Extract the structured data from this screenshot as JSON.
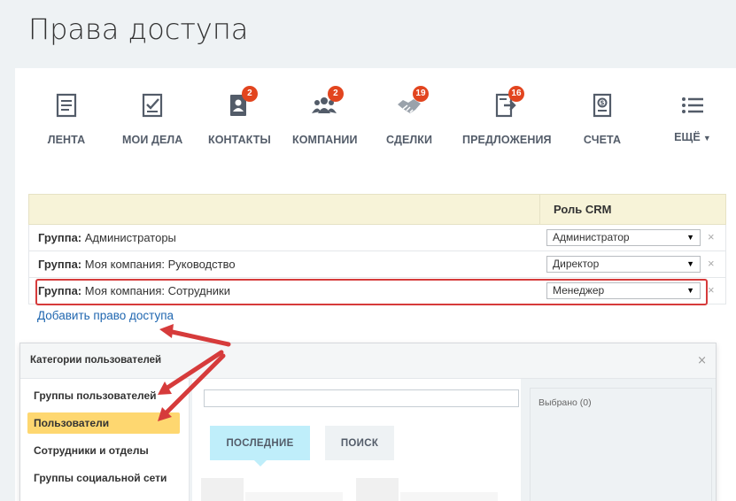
{
  "page": {
    "title": "Права доступа"
  },
  "toolbar": {
    "items": [
      {
        "label": "ЛЕНТА",
        "icon": "feed-icon",
        "badge": ""
      },
      {
        "label": "МОИ ДЕЛА",
        "icon": "tasks-icon",
        "badge": ""
      },
      {
        "label": "КОНТАКТЫ",
        "icon": "contacts-icon",
        "badge": "2"
      },
      {
        "label": "КОМПАНИИ",
        "icon": "companies-icon",
        "badge": "2"
      },
      {
        "label": "СДЕЛКИ",
        "icon": "deals-icon",
        "badge": "19"
      },
      {
        "label": "ПРЕДЛОЖЕНИЯ",
        "icon": "quotes-icon",
        "badge": "16"
      },
      {
        "label": "СЧЕТА",
        "icon": "invoices-icon",
        "badge": ""
      },
      {
        "label": "ЕЩЁ",
        "icon": "more-icon",
        "badge": ""
      }
    ]
  },
  "rights": {
    "role_header": "Роль CRM",
    "rows": [
      {
        "prefix": "Группа:",
        "name": "Администраторы",
        "role": "Администратор"
      },
      {
        "prefix": "Группа:",
        "name": "Моя компания: Руководство",
        "role": "Директор"
      },
      {
        "prefix": "Группа:",
        "name": "Моя компания: Сотрудники",
        "role": "Менеджер"
      }
    ],
    "add_link": "Добавить право доступа"
  },
  "dialog": {
    "title": "Категории пользователей",
    "categories": [
      "Группы пользователей",
      "Пользователи",
      "Сотрудники и отделы",
      "Группы социальной сети"
    ],
    "active_category": "Пользователи",
    "search_value": "",
    "tabs": {
      "recent": "ПОСЛЕДНИЕ",
      "search": "ПОИСК"
    },
    "selected_label": "Выбрано (0)"
  },
  "colors": {
    "accent_yellow": "#fed770",
    "badge_red": "#e2451f",
    "highlight_red": "#d63b3b",
    "link_blue": "#2067b0",
    "tab_blue": "#bfeefa"
  }
}
